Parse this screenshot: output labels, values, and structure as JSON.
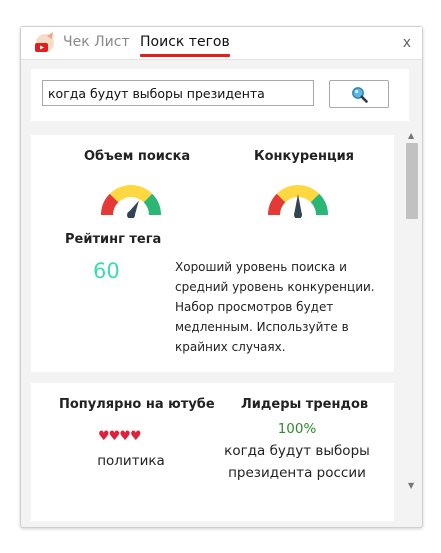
{
  "header": {
    "tabs": [
      {
        "label": "Чек Лист",
        "active": false
      },
      {
        "label": "Поиск тегов",
        "active": true
      }
    ],
    "close_label": "x",
    "accent_color": "#e02020"
  },
  "search": {
    "value": "когда будут выборы президента",
    "button_icon": "search-icon"
  },
  "metrics": {
    "search_volume": {
      "label": "Объем поиска",
      "level": 0.62
    },
    "competition": {
      "label": "Конкуренция",
      "level": 0.5
    },
    "rating": {
      "label": "Рейтинг тега",
      "value": "60"
    },
    "description": "Хороший уровень поиска и средний уровень конкуренции. Набор просмотров будет медленным. Используйте в крайних случаях."
  },
  "trends": {
    "popular": {
      "label": "Популярно на ютубе",
      "hearts": "♥♥♥♥",
      "term": "политика"
    },
    "leaders": {
      "label": "Лидеры трендов",
      "percent": "100%",
      "term_line1": "когда будут выборы",
      "term_line2": "президента россии"
    }
  },
  "colors": {
    "gauge_red": "#e53935",
    "gauge_yellow": "#ffd740",
    "gauge_green": "#2bb673",
    "needle": "#2f4554",
    "score": "#3ddbb0",
    "percent": "#2e8b2e"
  }
}
